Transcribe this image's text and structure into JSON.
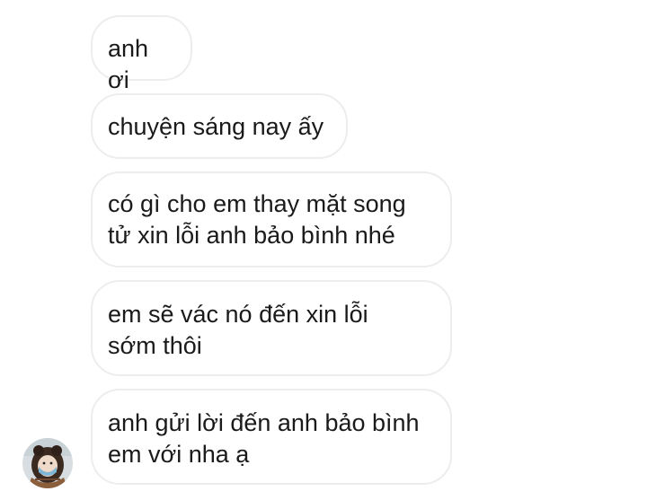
{
  "conversation": {
    "messages": [
      {
        "text": "anh ơi"
      },
      {
        "text": "chuyện sáng nay ấy"
      },
      {
        "text": "có gì cho em thay mặt song\ntử xin lỗi anh bảo bình nhé"
      },
      {
        "text": "em sẽ vác nó đến xin lỗi\nsớm thôi"
      },
      {
        "text": "anh gửi lời đến anh bảo bình\nem với nha ạ"
      }
    ],
    "sender": {
      "avatar_icon": "user-avatar-photo"
    }
  }
}
